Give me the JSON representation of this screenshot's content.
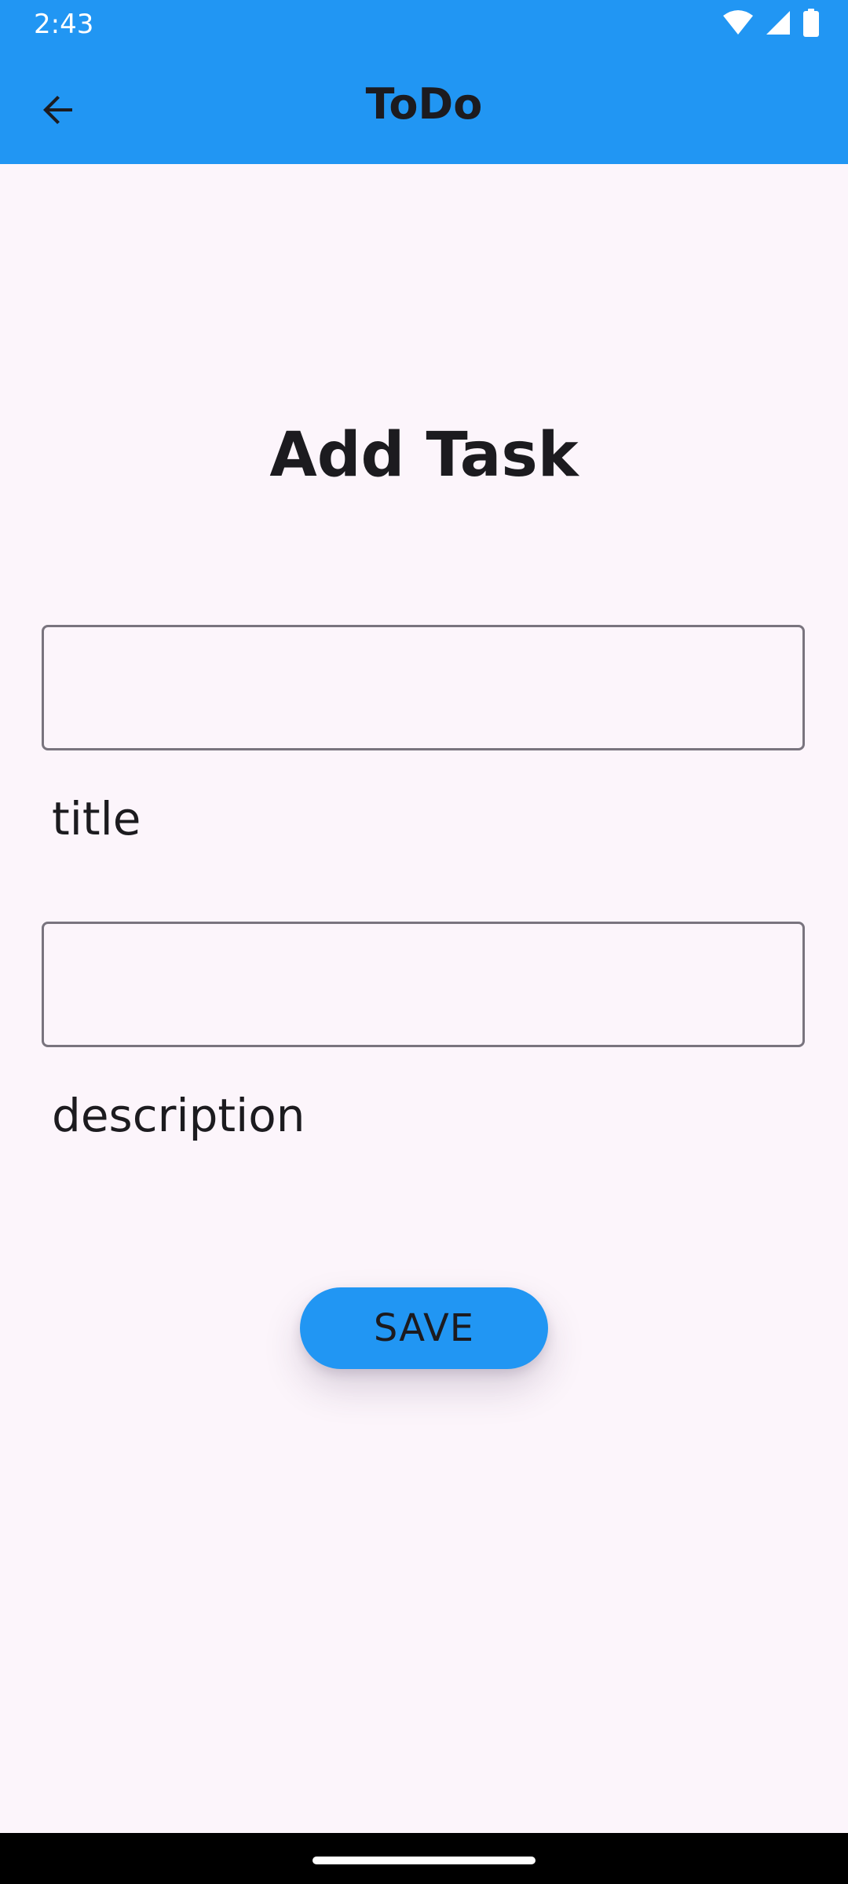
{
  "status_bar": {
    "time": "2:43",
    "icons": [
      "wifi-icon",
      "signal-icon",
      "battery-icon"
    ]
  },
  "app_bar": {
    "title": "ToDo",
    "back_icon": "arrow-back-icon",
    "background_color": "#2196f3"
  },
  "form": {
    "heading": "Add Task",
    "title_field": {
      "value": "",
      "label": "title"
    },
    "description_field": {
      "value": "",
      "label": "description"
    },
    "save_label": "SAVE"
  },
  "colors": {
    "accent": "#2196f3",
    "background": "#fcf5fb",
    "text": "#1c1b1f",
    "field_border": "#79747e"
  }
}
